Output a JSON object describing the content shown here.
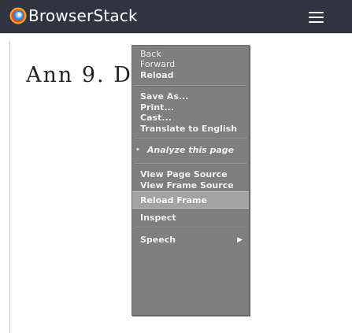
{
  "header": {
    "brand": "BrowserStack",
    "logo_icon": "browserstack-logo-icon",
    "menu_icon": "hamburger-menu-icon",
    "background_color": "#2f3540"
  },
  "page": {
    "heading": "Ann 9. D"
  },
  "context_menu": {
    "background_color": "#7f7f7f",
    "items": [
      {
        "label": "Back"
      },
      {
        "label": "Forward"
      },
      {
        "label": "Reload"
      },
      {
        "label": "Save As..."
      },
      {
        "label": "Print..."
      },
      {
        "label": "Cast..."
      },
      {
        "label": "Translate to English"
      },
      {
        "label": "Analyze this page"
      },
      {
        "label": "View Page Source"
      },
      {
        "label": "View Frame Source"
      },
      {
        "label": "Reload Frame"
      },
      {
        "label": "Inspect"
      },
      {
        "label": "Speech"
      }
    ]
  }
}
